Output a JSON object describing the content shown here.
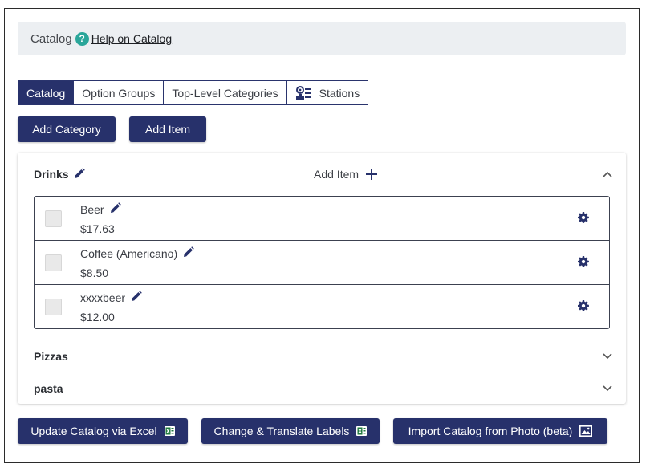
{
  "header": {
    "title": "Catalog",
    "help_icon": "question-icon",
    "help_link": "Help on Catalog"
  },
  "tabs": [
    {
      "label": "Catalog",
      "active": true
    },
    {
      "label": "Option Groups",
      "active": false
    },
    {
      "label": "Top-Level Categories",
      "active": false
    },
    {
      "label": "Stations",
      "active": false,
      "icon": "stations-icon"
    }
  ],
  "actions": {
    "add_category": "Add Category",
    "add_item": "Add Item"
  },
  "categories": [
    {
      "name": "Drinks",
      "expanded": true,
      "add_item_label": "Add Item",
      "items": [
        {
          "name": "Beer",
          "price": "$17.63"
        },
        {
          "name": "Coffee (Americano)",
          "price": "$8.50"
        },
        {
          "name": "xxxxbeer",
          "price": "$12.00"
        }
      ]
    },
    {
      "name": "Pizzas",
      "expanded": false
    },
    {
      "name": "pasta",
      "expanded": false
    }
  ],
  "bottom_actions": [
    {
      "label": "Update Catalog via Excel",
      "icon": "excel-icon"
    },
    {
      "label": "Change & Translate Labels",
      "icon": "excel-icon"
    },
    {
      "label": "Import Catalog from Photo (beta)",
      "icon": "image-icon"
    }
  ],
  "colors": {
    "primary": "#27316b",
    "help_icon": "#2aa69a",
    "excel_green": "#1f7a3e",
    "header_bg": "#eceff2"
  }
}
